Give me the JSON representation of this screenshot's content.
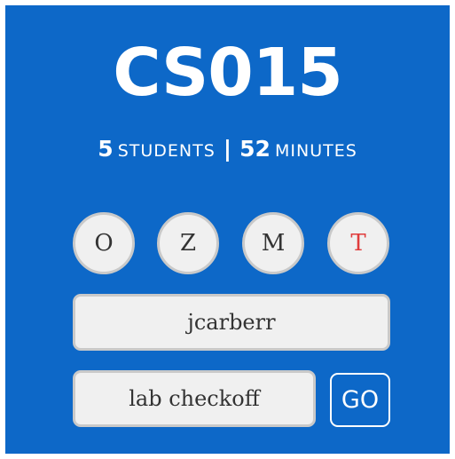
{
  "course": {
    "title": "CS015"
  },
  "stats": {
    "students_count": "5",
    "students_label": "STUDENTS",
    "separator": "|",
    "minutes_count": "52",
    "minutes_label": "MINUTES"
  },
  "actions": [
    {
      "label": "O",
      "color": "#333333"
    },
    {
      "label": "Z",
      "color": "#333333"
    },
    {
      "label": "M",
      "color": "#333333"
    },
    {
      "label": "T",
      "color": "#e03c3c"
    }
  ],
  "login_field": {
    "value": "jcarberr"
  },
  "reason_field": {
    "value": "lab checkoff"
  },
  "submit": {
    "label": "GO"
  },
  "colors": {
    "background": "#0d68c8",
    "button_fill": "#f0f0f0",
    "button_border": "#c9c9c9",
    "alert": "#e03c3c"
  }
}
